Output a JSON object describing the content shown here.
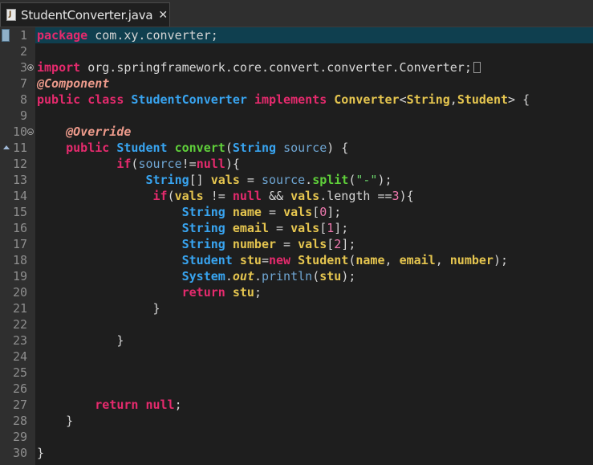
{
  "tab": {
    "title": "StudentConverter.java",
    "close": "✕"
  },
  "editor": {
    "lines": [
      {
        "n": "1",
        "tokens": [
          [
            "k",
            "package"
          ],
          [
            "o",
            " com.xy.converter;"
          ]
        ]
      },
      {
        "n": "2",
        "tokens": []
      },
      {
        "n": "3",
        "tokens": [
          [
            "k",
            "import"
          ],
          [
            "o",
            " org.springframework.core.convert.converter.Converter;"
          ]
        ]
      },
      {
        "n": "7",
        "tokens": [
          [
            "a",
            "@Component"
          ]
        ]
      },
      {
        "n": "8",
        "tokens": [
          [
            "k",
            "public"
          ],
          [
            "o",
            " "
          ],
          [
            "k",
            "class"
          ],
          [
            "o",
            " "
          ],
          [
            "t",
            "StudentConverter"
          ],
          [
            "o",
            " "
          ],
          [
            "k",
            "implements"
          ],
          [
            "o",
            " "
          ],
          [
            "v",
            "Converter"
          ],
          [
            "o",
            "<"
          ],
          [
            "v",
            "String"
          ],
          [
            "o",
            ","
          ],
          [
            "v",
            "Student"
          ],
          [
            "o",
            "> {"
          ]
        ]
      },
      {
        "n": "9",
        "tokens": []
      },
      {
        "n": "10",
        "tokens": [
          [
            "o",
            "    "
          ],
          [
            "a",
            "@Override"
          ]
        ]
      },
      {
        "n": "11",
        "tokens": [
          [
            "o",
            "    "
          ],
          [
            "k",
            "public"
          ],
          [
            "o",
            " "
          ],
          [
            "t",
            "Student"
          ],
          [
            "o",
            " "
          ],
          [
            "m",
            "convert"
          ],
          [
            "o",
            "("
          ],
          [
            "t",
            "String"
          ],
          [
            "o",
            " "
          ],
          [
            "p",
            "source"
          ],
          [
            "o",
            ") {"
          ]
        ]
      },
      {
        "n": "12",
        "tokens": [
          [
            "o",
            "           "
          ],
          [
            "k",
            "if"
          ],
          [
            "o",
            "("
          ],
          [
            "p",
            "source"
          ],
          [
            "o",
            "!="
          ],
          [
            "k",
            "null"
          ],
          [
            "o",
            "){"
          ]
        ]
      },
      {
        "n": "13",
        "tokens": [
          [
            "o",
            "               "
          ],
          [
            "t",
            "String"
          ],
          [
            "o",
            "[] "
          ],
          [
            "v",
            "vals"
          ],
          [
            "o",
            " = "
          ],
          [
            "p",
            "source"
          ],
          [
            "o",
            "."
          ],
          [
            "m",
            "split"
          ],
          [
            "o",
            "("
          ],
          [
            "s",
            "\"-\""
          ],
          [
            "o",
            ");"
          ]
        ]
      },
      {
        "n": "14",
        "tokens": [
          [
            "o",
            "                "
          ],
          [
            "k",
            "if"
          ],
          [
            "o",
            "("
          ],
          [
            "v",
            "vals"
          ],
          [
            "o",
            " != "
          ],
          [
            "k",
            "null"
          ],
          [
            "o",
            " && "
          ],
          [
            "v",
            "vals"
          ],
          [
            "o",
            ".length =="
          ],
          [
            "n",
            "3"
          ],
          [
            "o",
            "){"
          ]
        ]
      },
      {
        "n": "15",
        "tokens": [
          [
            "o",
            "                    "
          ],
          [
            "t",
            "String"
          ],
          [
            "o",
            " "
          ],
          [
            "v",
            "name"
          ],
          [
            "o",
            " = "
          ],
          [
            "v",
            "vals"
          ],
          [
            "o",
            "["
          ],
          [
            "n",
            "0"
          ],
          [
            "o",
            "];"
          ]
        ]
      },
      {
        "n": "16",
        "tokens": [
          [
            "o",
            "                    "
          ],
          [
            "t",
            "String"
          ],
          [
            "o",
            " "
          ],
          [
            "v",
            "email"
          ],
          [
            "o",
            " = "
          ],
          [
            "v",
            "vals"
          ],
          [
            "o",
            "["
          ],
          [
            "n",
            "1"
          ],
          [
            "o",
            "];"
          ]
        ]
      },
      {
        "n": "17",
        "tokens": [
          [
            "o",
            "                    "
          ],
          [
            "t",
            "String"
          ],
          [
            "o",
            " "
          ],
          [
            "v",
            "number"
          ],
          [
            "o",
            " = "
          ],
          [
            "v",
            "vals"
          ],
          [
            "o",
            "["
          ],
          [
            "n",
            "2"
          ],
          [
            "o",
            "];"
          ]
        ]
      },
      {
        "n": "18",
        "tokens": [
          [
            "o",
            "                    "
          ],
          [
            "t",
            "Student"
          ],
          [
            "o",
            " "
          ],
          [
            "v",
            "stu"
          ],
          [
            "o",
            "="
          ],
          [
            "k",
            "new"
          ],
          [
            "o",
            " "
          ],
          [
            "v",
            "Student"
          ],
          [
            "o",
            "("
          ],
          [
            "v",
            "name"
          ],
          [
            "o",
            ", "
          ],
          [
            "v",
            "email"
          ],
          [
            "o",
            ", "
          ],
          [
            "v",
            "number"
          ],
          [
            "o",
            ");"
          ]
        ]
      },
      {
        "n": "19",
        "tokens": [
          [
            "o",
            "                    "
          ],
          [
            "t",
            "System"
          ],
          [
            "o",
            "."
          ],
          [
            "f",
            "out"
          ],
          [
            "o",
            "."
          ],
          [
            "p",
            "println"
          ],
          [
            "o",
            "("
          ],
          [
            "v",
            "stu"
          ],
          [
            "o",
            ");"
          ]
        ]
      },
      {
        "n": "20",
        "tokens": [
          [
            "o",
            "                    "
          ],
          [
            "k",
            "return"
          ],
          [
            "o",
            " "
          ],
          [
            "v",
            "stu"
          ],
          [
            "o",
            ";"
          ]
        ]
      },
      {
        "n": "21",
        "tokens": [
          [
            "o",
            "                }"
          ]
        ]
      },
      {
        "n": "22",
        "tokens": []
      },
      {
        "n": "23",
        "tokens": [
          [
            "o",
            "           }"
          ]
        ]
      },
      {
        "n": "24",
        "tokens": []
      },
      {
        "n": "25",
        "tokens": []
      },
      {
        "n": "26",
        "tokens": []
      },
      {
        "n": "27",
        "tokens": [
          [
            "o",
            "        "
          ],
          [
            "k",
            "return"
          ],
          [
            "o",
            " "
          ],
          [
            "k",
            "null"
          ],
          [
            "o",
            ";"
          ]
        ]
      },
      {
        "n": "28",
        "tokens": [
          [
            "o",
            "    }"
          ]
        ]
      },
      {
        "n": "29",
        "tokens": []
      },
      {
        "n": "30",
        "tokens": [
          [
            "o",
            "}"
          ]
        ]
      }
    ],
    "current_line": "1",
    "collapsed_fold_line": "3",
    "expanded_fold_line": "10",
    "override_marker_line": "11"
  },
  "colors": {
    "keyword": "#e52a6d",
    "type": "#38a4f0",
    "method": "#5fcf3a",
    "variable": "#e5c54f",
    "annotation": "#ec9a8b",
    "string": "#6ad36a",
    "number": "#f07ab0",
    "background": "#1e1e1e",
    "current_line": "#0f3f4f"
  }
}
